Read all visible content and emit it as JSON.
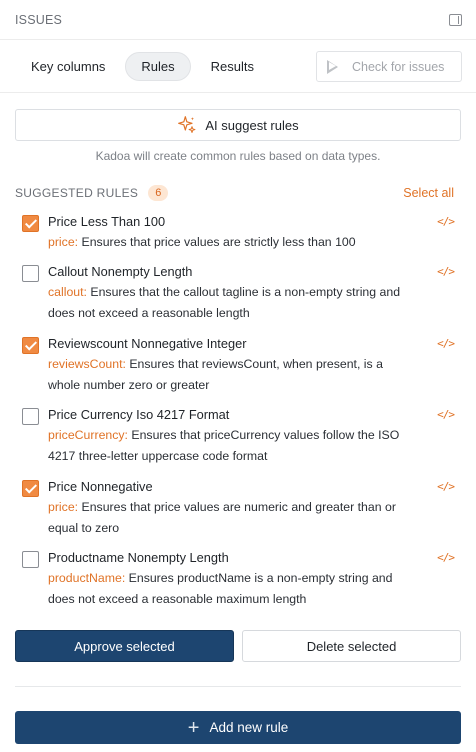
{
  "header": {
    "title": "ISSUES"
  },
  "tabs": [
    {
      "label": "Key columns",
      "active": false
    },
    {
      "label": "Rules",
      "active": true
    },
    {
      "label": "Results",
      "active": false
    }
  ],
  "check_button": {
    "label": "Check for issues"
  },
  "ai": {
    "button_label": "AI suggest rules",
    "hint": "Kadoa will create common rules based on data types."
  },
  "section": {
    "title": "SUGGESTED RULES",
    "count": "6",
    "select_all": "Select all"
  },
  "rules": [
    {
      "checked": true,
      "title": "Price Less Than 100",
      "field": "price:",
      "desc": "Ensures that price values are strictly less than 100"
    },
    {
      "checked": false,
      "title": "Callout Nonempty Length",
      "field": "callout:",
      "desc": "Ensures that the callout tagline is a non-empty string and does not exceed a reasonable length"
    },
    {
      "checked": true,
      "title": "Reviewscount Nonnegative Integer",
      "field": "reviewsCount:",
      "desc": "Ensures that reviewsCount, when present, is a whole number zero or greater"
    },
    {
      "checked": false,
      "title": "Price Currency Iso 4217 Format",
      "field": "priceCurrency:",
      "desc": "Ensures that priceCurrency values follow the ISO 4217 three-letter uppercase code format"
    },
    {
      "checked": true,
      "title": "Price Nonnegative",
      "field": "price:",
      "desc": "Ensures that price values are numeric and greater than or equal to zero"
    },
    {
      "checked": false,
      "title": "Productname Nonempty Length",
      "field": "productName:",
      "desc": "Ensures productName is a non-empty string and does not exceed a reasonable maximum length"
    }
  ],
  "code_glyph": "</>",
  "actions": {
    "approve": "Approve selected",
    "delete": "Delete selected",
    "add": "Add new rule"
  },
  "colors": {
    "accent": "#e07327",
    "primary": "#1d4570"
  }
}
